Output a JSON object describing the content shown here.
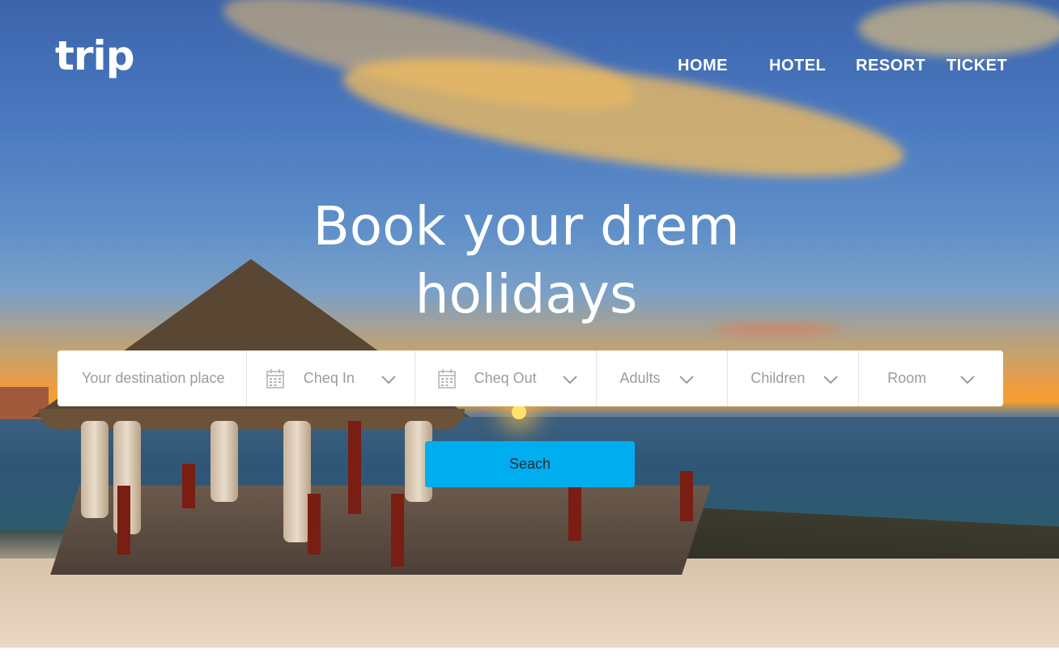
{
  "brand": {
    "logo_text": "trip"
  },
  "nav": {
    "items": [
      "HOME",
      "HOTEL",
      "RESORT",
      "TICKET"
    ]
  },
  "hero": {
    "headline_line1": "Book your drem",
    "headline_line2": "holidays"
  },
  "search": {
    "destination_placeholder": "Your destination place",
    "checkin_label": "Cheq In",
    "checkout_label": "Cheq Out",
    "adults_label": "Adults",
    "children_label": "Children",
    "room_label": "Room",
    "button_label": "Seach"
  },
  "colors": {
    "accent": "#00aeef",
    "text_white": "#ffffff",
    "field_text": "#9c9c9c"
  },
  "icons": [
    "calendar-icon",
    "chevron-down-icon"
  ]
}
